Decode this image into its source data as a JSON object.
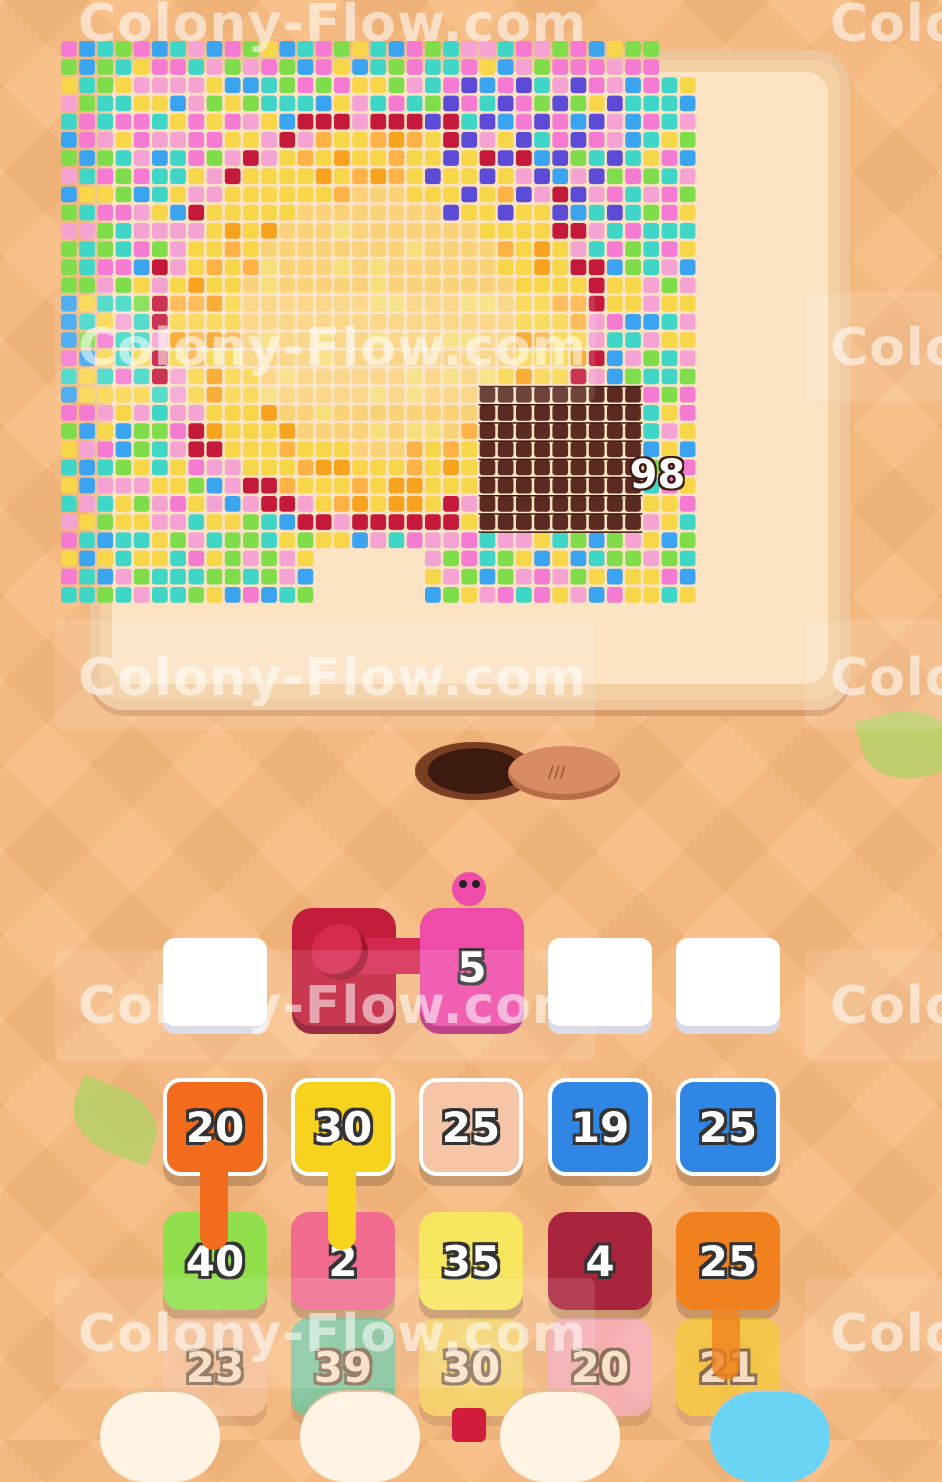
{
  "watermark": "Colony-Flow.com",
  "watermark_partial": "Colo",
  "board": {
    "progress": "98"
  },
  "pipe": {
    "count": "5"
  },
  "tiles": [
    {
      "value": "20",
      "color": "#f36b1c",
      "top": true
    },
    {
      "value": "30",
      "color": "#f7d21f",
      "top": true
    },
    {
      "value": "25",
      "color": "#f6c4a7",
      "top": true
    },
    {
      "value": "19",
      "color": "#2f86e5",
      "top": true
    },
    {
      "value": "25",
      "color": "#2f86e5",
      "top": true
    },
    {
      "value": "40",
      "color": "#8fe04a",
      "top": false
    },
    {
      "value": "2",
      "color": "#f06b8f",
      "top": false
    },
    {
      "value": "35",
      "color": "#f6e55e",
      "top": false
    },
    {
      "value": "4",
      "color": "#a8253d",
      "top": false
    },
    {
      "value": "25",
      "color": "#f0811e",
      "top": false
    },
    {
      "value": "23",
      "color": "#f6c4a7",
      "top": false
    },
    {
      "value": "39",
      "color": "#2fcfb7",
      "top": false
    },
    {
      "value": "30",
      "color": "#f6e55e",
      "top": false
    },
    {
      "value": "20",
      "color": "#f7a8d8",
      "top": false
    },
    {
      "value": "21",
      "color": "#f7d21f",
      "top": false
    }
  ],
  "colors": {
    "background": "#f8b97c",
    "board": "#f3cfa1",
    "pixel_palette": [
      "#3fd6c7",
      "#7fdc4a",
      "#f47ad2",
      "#3aa4f0",
      "#f7d64a",
      "#fad27a",
      "#f8a31e",
      "#c5193c",
      "#f4a3d3",
      "#5b4bd7",
      "#ffffff",
      "#5b2a20",
      "#f6e07c",
      "#ffb347"
    ]
  }
}
